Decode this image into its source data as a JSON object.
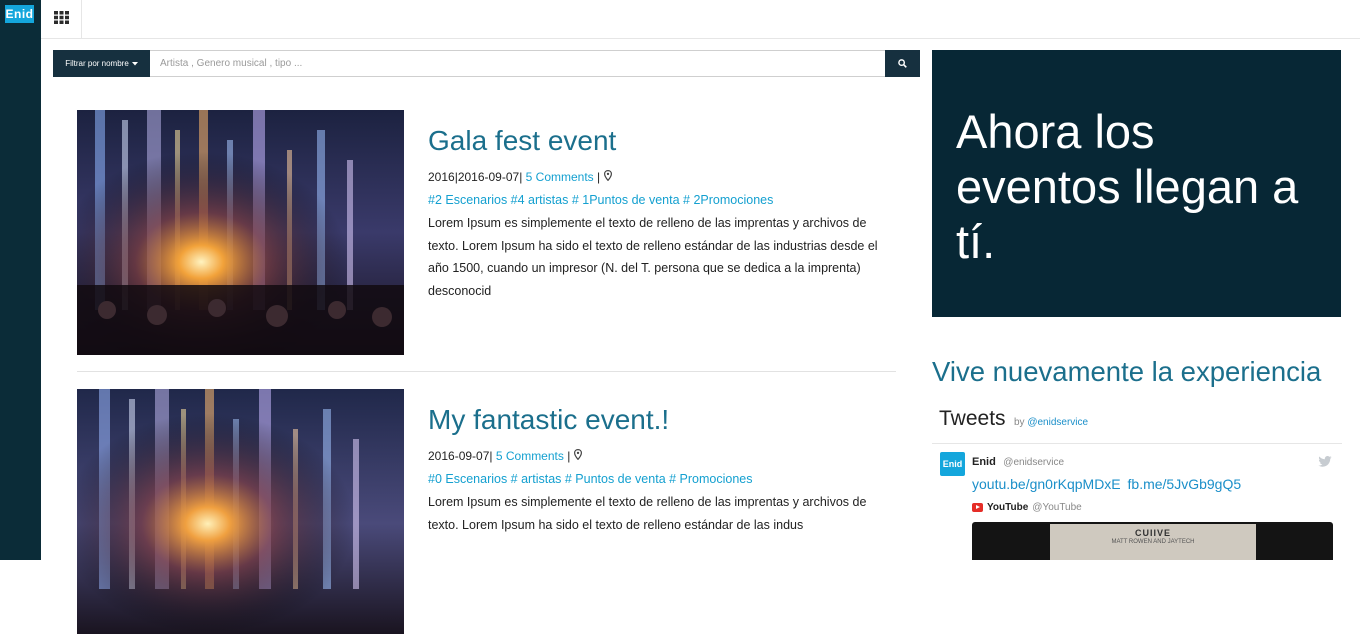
{
  "app": {
    "logo_text": "Enid"
  },
  "colors": {
    "sidebar": "#0b2c38",
    "brand_blue": "#14a6dc",
    "title_teal": "#1b6f8c",
    "link_blue": "#14a0d0",
    "promo_bg": "#072735",
    "search_button_bg": "#16303f"
  },
  "icons": {
    "apps": "grid-icon",
    "search": "search-icon",
    "dropdown": "caret-down-icon",
    "location": "map-marker-icon",
    "twitter": "twitter-bird-icon",
    "youtube": "youtube-icon"
  },
  "search": {
    "filter_label": "Filtrar por nombre",
    "placeholder": "Artista , Genero musical , tipo ...",
    "value": ""
  },
  "events": [
    {
      "title": "Gala fest event",
      "date": "2016|2016-09-07|",
      "comments": "5 Comments",
      "meta_sep": "|",
      "tags": "#2 Escenarios #4 artistas # 1Puntos de venta # 2Promociones",
      "description": "Lorem Ipsum es simplemente el texto de relleno de las imprentas y archivos de texto. Lorem Ipsum ha sido el texto de relleno estándar de las industrias desde el año 1500, cuando un impresor (N. del T. persona que se dedica a la imprenta) desconocid"
    },
    {
      "title": "My fantastic event.!",
      "date": "2016-09-07|",
      "comments": "5 Comments",
      "meta_sep": "|",
      "tags": "#0 Escenarios # artistas # Puntos de venta # Promociones",
      "description": "Lorem Ipsum es simplemente el texto de relleno de las imprentas y archivos de texto. Lorem Ipsum ha sido el texto de relleno estándar de las indus"
    }
  ],
  "promo": {
    "text": "Ahora los eventos llegan a tí."
  },
  "relive": {
    "heading": "Vive nuevamente la experiencia"
  },
  "tweets": {
    "title": "Tweets",
    "by_label": "by",
    "by_handle": "@enidservice",
    "avatar_text": "Enid",
    "author": "Enid",
    "author_handle": "@enidservice",
    "link1": "youtu.be/gn0rKqpMDxE",
    "link2": "fb.me/5JvGb9gQ5",
    "card_source_name": "YouTube",
    "card_source_handle": "@YouTube",
    "card_paper_title": "CUIIVE",
    "card_paper_sub": "MATT ROWEN AND JAYTECH"
  }
}
